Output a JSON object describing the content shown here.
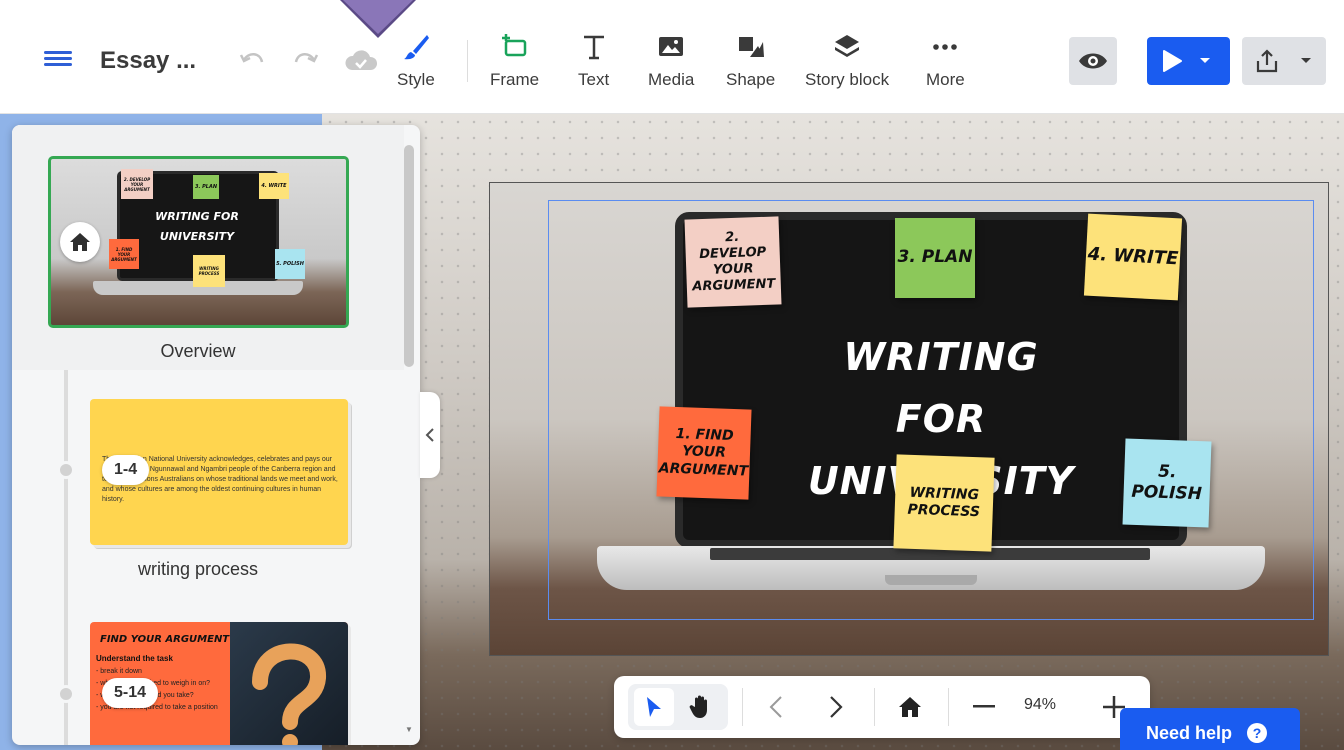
{
  "header": {
    "doc_title": "Essay ...",
    "tools": [
      {
        "label": "Style",
        "icon": "brush-icon"
      },
      {
        "label": "Frame",
        "icon": "frame-add-icon"
      },
      {
        "label": "Text",
        "icon": "text-icon"
      },
      {
        "label": "Media",
        "icon": "image-icon"
      },
      {
        "label": "Shape",
        "icon": "shapes-icon"
      },
      {
        "label": "Story block",
        "icon": "layers-icon"
      },
      {
        "label": "More",
        "icon": "more-dots-icon"
      }
    ],
    "accent_color": "#1a5cf0"
  },
  "canvas": {
    "slide_title_line1": "WRITING FOR",
    "slide_title_line2": "UNIVERSITY",
    "notes": {
      "develop": "2. DEVELOP YOUR ARGUMENT",
      "plan": "3. PLAN",
      "write": "4. WRITE",
      "find": "1. FIND YOUR ARGUMENT",
      "process": "WRITING PROCESS",
      "polish": "5. POLISH"
    }
  },
  "sidebar": {
    "overview_label": "Overview",
    "overview_thumb": {
      "title_line1": "WRITING FOR",
      "title_line2": "UNIVERSITY",
      "notes": {
        "develop": "2. DEVELOP YOUR ARGUMENT",
        "plan": "3. PLAN",
        "write": "4. WRITE",
        "find": "1. FIND YOUR ARGUMENT",
        "process": "WRITING PROCESS",
        "polish": "5. POLISH"
      }
    },
    "items": [
      {
        "range": "1-4",
        "label": "writing process",
        "thumb_text": "The Australian National University acknowledges, celebrates and pays our respects to the Ngunnawal and Ngambri people of the Canberra region and to all First Nations Australians on whose traditional lands we meet and work, and whose cultures are among the oldest continuing cultures in human history."
      },
      {
        "range": "5-14",
        "thumb_heading": "FIND YOUR ARGUMENT",
        "thumb_sub": "Understand the task",
        "thumb_lines": [
          "- break it down",
          "- what are you asked to weigh in on?",
          "- what position would you take?",
          "- you are not required to take a position"
        ]
      }
    ]
  },
  "controls": {
    "zoom": "94%"
  },
  "help": {
    "label": "Need help"
  }
}
